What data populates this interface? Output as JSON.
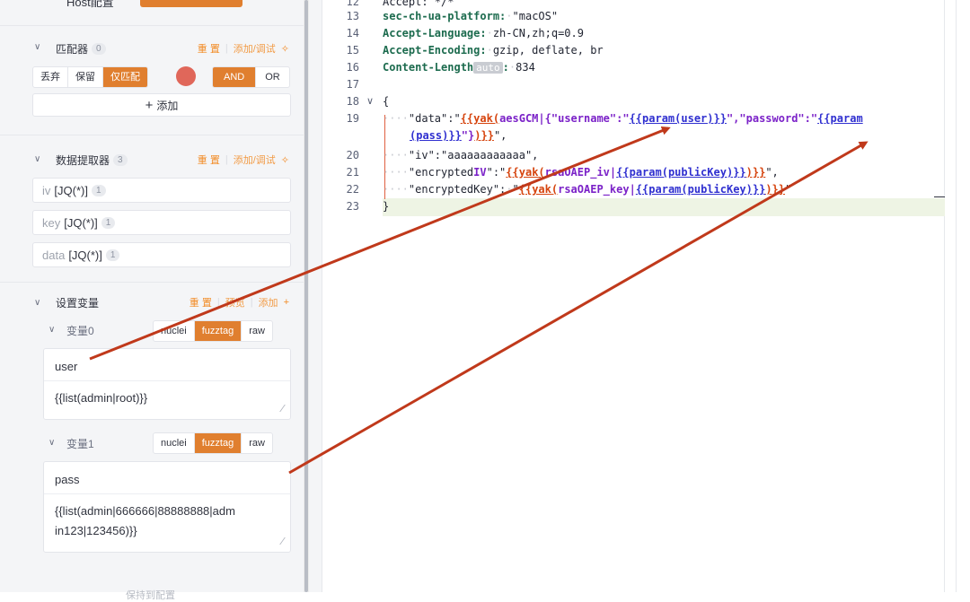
{
  "top_row": {
    "label": "Host配置"
  },
  "matcher": {
    "title": "匹配器",
    "count": "0",
    "reset": "重 置",
    "add_debug": "添加/调试",
    "modes": [
      "丢弃",
      "保留",
      "仅匹配"
    ],
    "active_mode": "仅匹配",
    "logic": [
      "AND",
      "OR"
    ],
    "active_logic": "AND",
    "add_label": "添加"
  },
  "extractor": {
    "title": "数据提取器",
    "count": "3",
    "reset": "重 置",
    "add_debug": "添加/调试",
    "items": [
      {
        "key": "iv",
        "expr": "[JQ(*)]",
        "count": "1"
      },
      {
        "key": "key",
        "expr": "[JQ(*)]",
        "count": "1"
      },
      {
        "key": "data",
        "expr": "[JQ(*)]",
        "count": "1"
      }
    ]
  },
  "variables": {
    "title": "设置变量",
    "reset": "重 置",
    "preview": "预览",
    "add": "添加",
    "items": [
      {
        "label": "变量0",
        "modes": [
          "nuclei",
          "fuzztag",
          "raw"
        ],
        "active": "fuzztag",
        "name": "user",
        "value": "{{list(admin|root)}}"
      },
      {
        "label": "变量1",
        "modes": [
          "nuclei",
          "fuzztag",
          "raw"
        ],
        "active": "fuzztag",
        "name": "pass",
        "value_line1": "{{list(admin|666666|88888888|adm",
        "value_line2": "in123|123456)}}"
      }
    ]
  },
  "bottom_hint": "保持到配置",
  "editor": {
    "lines": [
      {
        "n": "12",
        "text": "Accept: */*"
      },
      {
        "n": "13",
        "key": "sec-ch-ua-platform:",
        "val": "\"macOS\""
      },
      {
        "n": "14",
        "key": "Accept-Language:",
        "val": "zh-CN,zh;q=0.9"
      },
      {
        "n": "15",
        "key": "Accept-Encoding:",
        "val": "gzip, deflate, br"
      },
      {
        "n": "16",
        "key": "Content-Length",
        "badge": "auto",
        "val": "834"
      },
      {
        "n": "17"
      },
      {
        "n": "18",
        "text": "{"
      },
      {
        "n": "19"
      },
      {
        "n": "20"
      },
      {
        "n": "21"
      },
      {
        "n": "22"
      },
      {
        "n": "23",
        "text": "}"
      }
    ],
    "body": {
      "data_key": "\"data\":\"",
      "yak1": "{{yak(",
      "aes": "aesGCM",
      "json_open": "|{\"username\":\"",
      "param_user": "{{param(user)}}",
      "mid": "\",\"password\":\"",
      "param_pass_a": "{{param",
      "param_pass_b": "(pass)}}",
      "close1": "\"}",
      "close2": ")}}",
      "tail1": "\",",
      "iv_line": "\"iv\":\"aaaaaaaaaaaa\",",
      "encIV_key": "\"encrypted",
      "encIV_key2": "IV",
      "encIV_mid": "\":\"",
      "yak2": "{{yak(",
      "rsa_iv": "rsaOAEP_iv",
      "param_pk": "{{param(publicKey)}}",
      "close3": ")}}",
      "tail2": "\",",
      "encKey_key": "\"encryptedKey\":",
      "encKey_mid": "\"",
      "rsa_key": "rsaOAEP_key",
      "tail3": "\""
    }
  },
  "colors": {
    "accent": "#e07f2f",
    "arrow": "#c0391b",
    "toggle": "#e0675a"
  }
}
